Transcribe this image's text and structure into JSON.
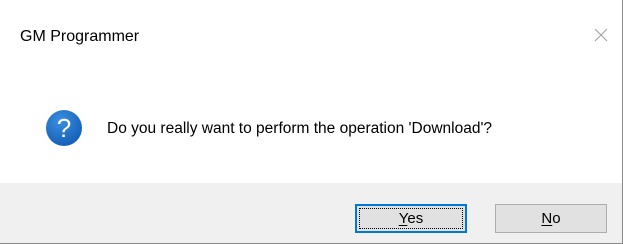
{
  "window": {
    "title": "GM Programmer",
    "close_icon": "close-icon"
  },
  "dialog": {
    "icon": "question-icon",
    "icon_glyph": "?",
    "icon_color": "#1f6fc9",
    "message": "Do you really want to perform the operation 'Download'?"
  },
  "buttons": {
    "yes": {
      "mnemonic": "Y",
      "rest": "es",
      "is_default": true
    },
    "no": {
      "mnemonic": "N",
      "rest": "o",
      "is_default": false
    }
  },
  "colors": {
    "footer_bg": "#f0f0f0",
    "button_bg": "#e1e1e1",
    "default_button_border": "#0078d7"
  }
}
